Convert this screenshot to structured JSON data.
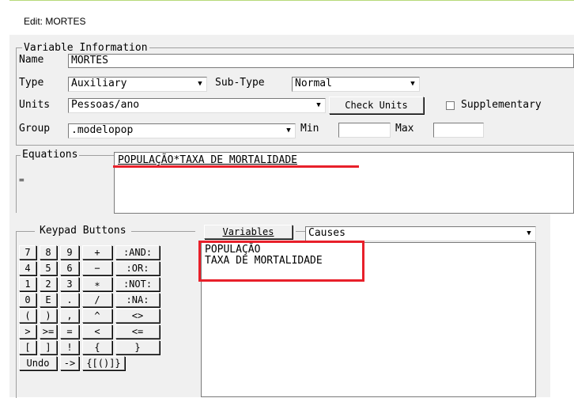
{
  "window": {
    "title": "Edit: MORTES"
  },
  "variable_info": {
    "legend": "Variable Information",
    "name_label": "Name",
    "name_value": "MORTES",
    "type_label": "Type",
    "type_value": "Auxiliary",
    "subtype_label": "Sub-Type",
    "subtype_value": "Normal",
    "units_label": "Units",
    "units_value": "Pessoas/ano",
    "check_units_label": "Check Units",
    "supplementary_label": "Supplementary",
    "supplementary_checked": false,
    "group_label": "Group",
    "group_value": ".modelopop",
    "min_label": "Min",
    "min_value": "",
    "max_label": "Max",
    "max_value": ""
  },
  "equations": {
    "legend": "Equations",
    "equals": "=",
    "value": "POPULAÇÃO*TAXA DE MORTALIDADE"
  },
  "keypad": {
    "legend": "Keypad Buttons",
    "rows": [
      [
        "7",
        "8",
        "9",
        "+",
        ":AND:"
      ],
      [
        "4",
        "5",
        "6",
        "−",
        ":OR:"
      ],
      [
        "1",
        "2",
        "3",
        "∗",
        ":NOT:"
      ],
      [
        "0",
        "E",
        ".",
        "/",
        ":NA:"
      ],
      [
        "(",
        ")",
        ",",
        "^",
        "<>"
      ],
      [
        ">",
        ">=",
        "=",
        "<",
        "<="
      ],
      [
        "[",
        "]",
        "!",
        "{",
        "}"
      ]
    ],
    "bottom_row": [
      "Undo",
      "->",
      "{[()]}"
    ]
  },
  "variables": {
    "button_label": "Variables",
    "causes_value": "Causes",
    "items": [
      "POPULAÇÃO",
      "TAXA DE MORTALIDADE"
    ]
  },
  "colors": {
    "highlight": "#e8202a",
    "panel": "#f0f0f0"
  }
}
